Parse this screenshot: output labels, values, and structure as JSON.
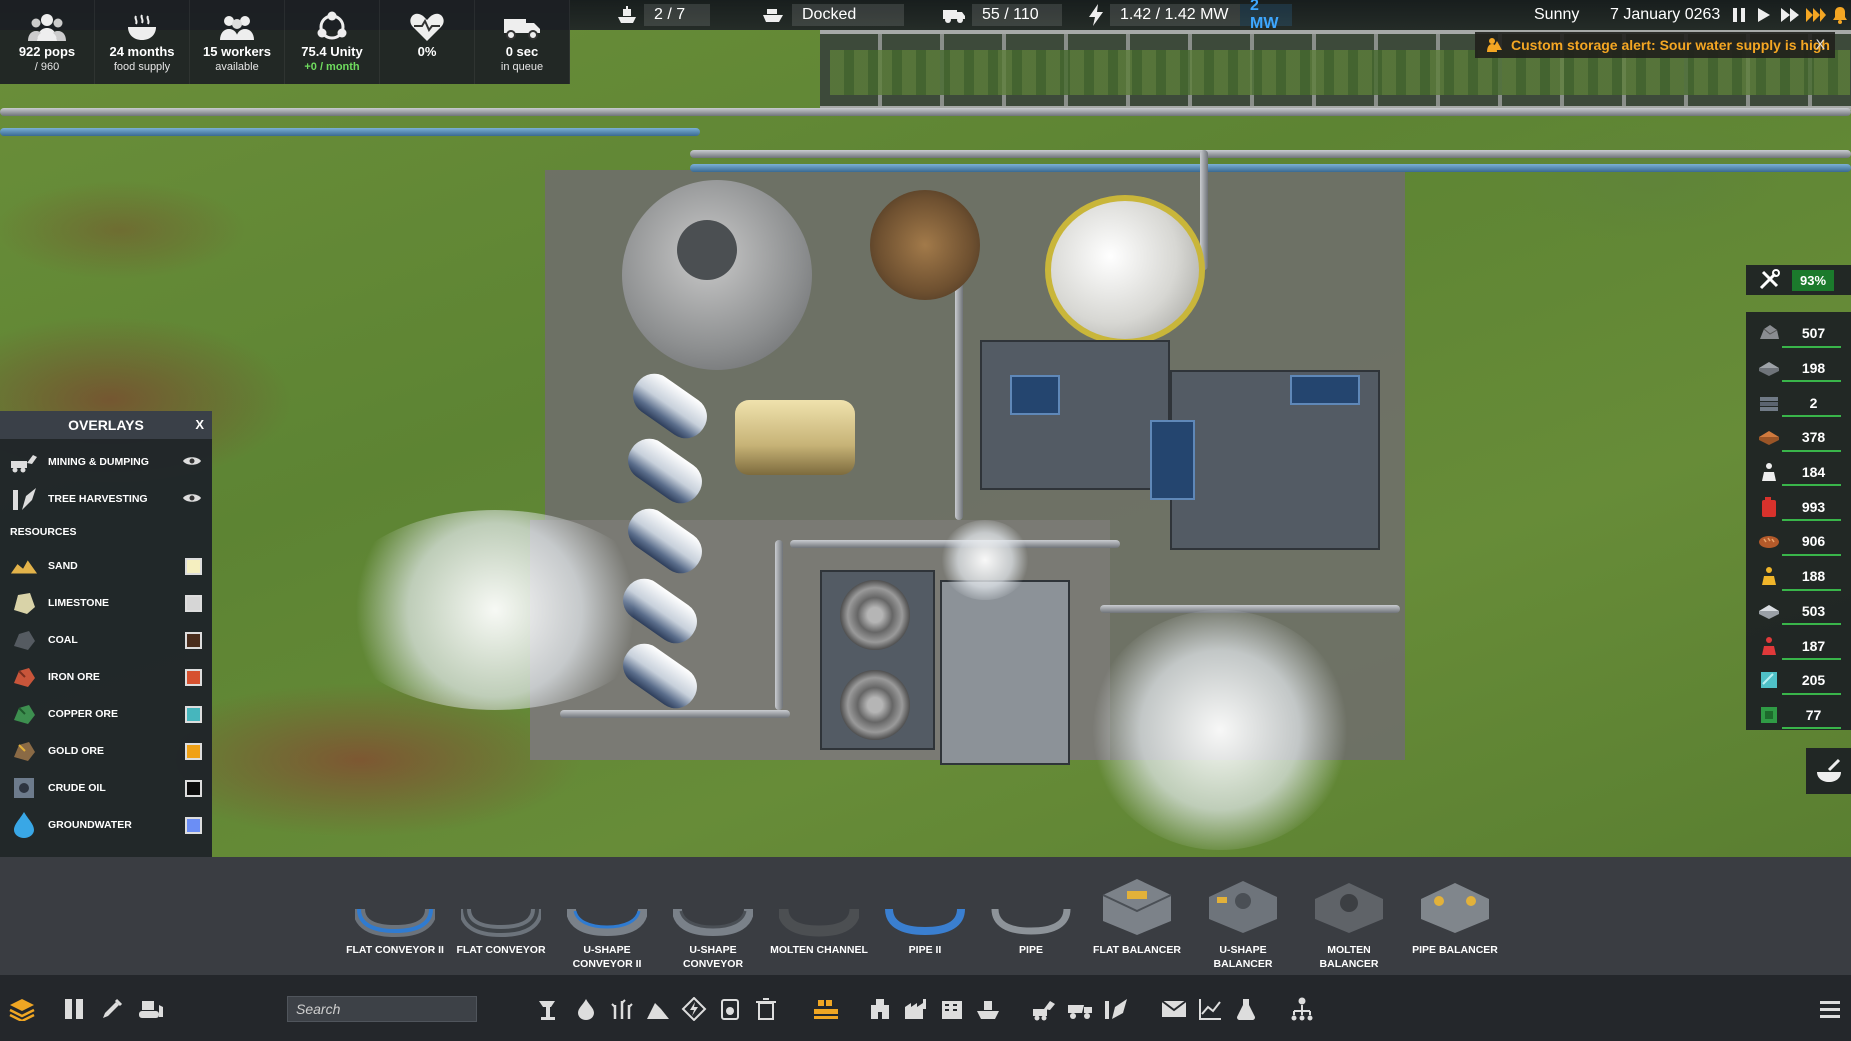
{
  "top_stats": [
    {
      "icon": "population-icon",
      "line1": "922 pops",
      "line2": "/ 960",
      "green": false
    },
    {
      "icon": "food-icon",
      "line1": "24 months",
      "line2": "food supply",
      "green": false
    },
    {
      "icon": "workers-icon",
      "line1": "15 workers",
      "line2": "available",
      "green": false
    },
    {
      "icon": "unity-icon",
      "line1": "75.4 Unity",
      "line2": "+0 / month",
      "green": true
    },
    {
      "icon": "health-icon",
      "line1": "0%",
      "line2": "",
      "green": false
    },
    {
      "icon": "vehicle-queue-icon",
      "line1": "0 sec",
      "line2": "in queue",
      "green": false
    }
  ],
  "topbar": {
    "ships": "2 / 7",
    "dock_status": "Docked",
    "vehicles": "55 / 110",
    "power": "1.42 / 1.42 MW",
    "power_capacity": "2 MW",
    "weather": "Sunny",
    "date": "7 January 0263"
  },
  "alert": {
    "text": "Custom storage alert: Sour water supply is high",
    "close": "X"
  },
  "maintenance": {
    "value": "93%"
  },
  "resources": [
    {
      "icon": "rock-icon",
      "value": "507"
    },
    {
      "icon": "iron-plate-icon",
      "value": "198"
    },
    {
      "icon": "steel-plate-icon",
      "value": "2"
    },
    {
      "icon": "copper-plate-icon",
      "value": "378"
    },
    {
      "icon": "construction-parts-icon",
      "value": "184"
    },
    {
      "icon": "fuel-canister-icon",
      "value": "993"
    },
    {
      "icon": "bread-icon",
      "value": "906"
    },
    {
      "icon": "gold-parts-icon",
      "value": "188"
    },
    {
      "icon": "aluminum-plate-icon",
      "value": "503"
    },
    {
      "icon": "red-parts-icon",
      "value": "187"
    },
    {
      "icon": "glass-icon",
      "value": "205"
    },
    {
      "icon": "electronics-icon",
      "value": "77"
    }
  ],
  "overlays": {
    "title": "OVERLAYS",
    "close": "X",
    "toggles": [
      {
        "icon": "mining-dumping-icon",
        "label": "MINING & DUMPING"
      },
      {
        "icon": "tree-harvesting-icon",
        "label": "TREE HARVESTING"
      }
    ],
    "resources_title": "RESOURCES",
    "resources": [
      {
        "icon": "sand-icon",
        "label": "SAND",
        "color": "#f5efc0"
      },
      {
        "icon": "limestone-icon",
        "label": "LIMESTONE",
        "color": "#d6d6d6"
      },
      {
        "icon": "coal-icon",
        "label": "COAL",
        "color": "#4a2d1c"
      },
      {
        "icon": "iron-ore-icon",
        "label": "IRON ORE",
        "color": "#d6512f"
      },
      {
        "icon": "copper-ore-icon",
        "label": "COPPER ORE",
        "color": "#46b6bd"
      },
      {
        "icon": "gold-ore-icon",
        "label": "GOLD ORE",
        "color": "#f0a116"
      },
      {
        "icon": "crude-oil-icon",
        "label": "CRUDE OIL",
        "color": "#0c0c0c"
      },
      {
        "icon": "groundwater-icon",
        "label": "GROUNDWATER",
        "color": "#6b8ef5"
      }
    ]
  },
  "build_items": [
    {
      "icon": "flat-conveyor-ii-icon",
      "label": "FLAT CONVEYOR II"
    },
    {
      "icon": "flat-conveyor-icon",
      "label": "FLAT CONVEYOR"
    },
    {
      "icon": "u-shape-conveyor-ii-icon",
      "label": "U-SHAPE CONVEYOR II"
    },
    {
      "icon": "u-shape-conveyor-icon",
      "label": "U-SHAPE CONVEYOR"
    },
    {
      "icon": "molten-channel-icon",
      "label": "MOLTEN CHANNEL"
    },
    {
      "icon": "pipe-ii-icon",
      "label": "PIPE II"
    },
    {
      "icon": "pipe-icon",
      "label": "PIPE"
    },
    {
      "icon": "flat-balancer-icon",
      "label": "FLAT BALANCER"
    },
    {
      "icon": "u-shape-balancer-icon",
      "label": "U-SHAPE BALANCER"
    },
    {
      "icon": "molten-balancer-icon",
      "label": "MOLTEN BALANCER"
    },
    {
      "icon": "pipe-balancer-icon",
      "label": "PIPE BALANCER"
    }
  ],
  "toolbar": {
    "search_placeholder": "Search"
  }
}
